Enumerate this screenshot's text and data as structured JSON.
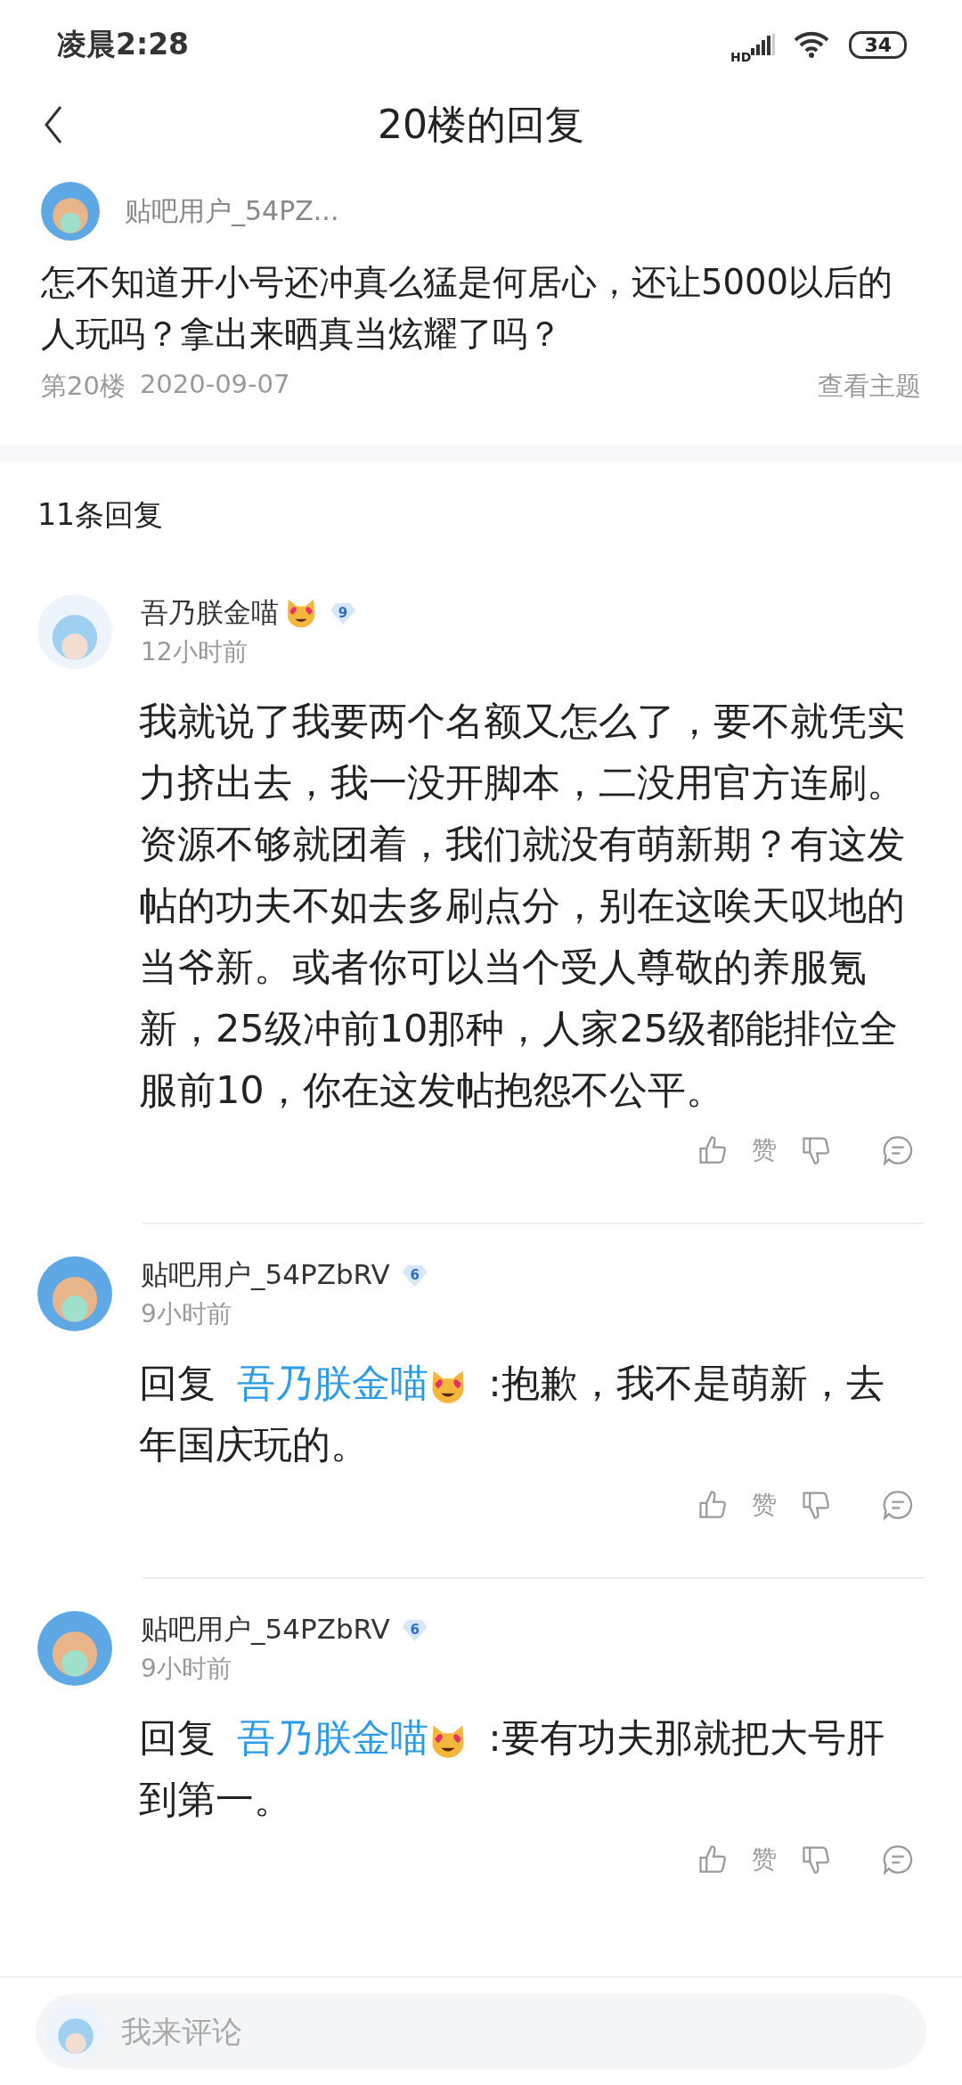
{
  "status_bar": {
    "time": "凌晨2:28",
    "network": "HD",
    "battery": "34"
  },
  "header": {
    "title": "20楼的回复"
  },
  "post": {
    "author": "贴吧用户_54PZ...",
    "text": "怎不知道开小号还冲真么猛是何居心，还让5000以后的人玩吗？拿出来晒真当炫耀了吗？",
    "floor": "第20楼",
    "date": "2020-09-07",
    "view_topic": "查看主题"
  },
  "replies_count": "11条回复",
  "replies": [
    {
      "kind": "plain",
      "author": "吾乃朕金喵",
      "author_emoji": true,
      "level": "9",
      "time": "12小时前",
      "text": "我就说了我要两个名额又怎么了，要不就凭实力挤出去，我一没开脚本，二没用官方连刷。资源不够就团着，我们就没有萌新期？有这发帖的功夫不如去多刷点分，别在这唉天叹地的当爷新。或者你可以当个受人尊敬的养服氪新，25级冲前10那种，人家25级都能排位全服前10，你在这发帖抱怨不公平。",
      "like": "赞"
    },
    {
      "kind": "reply",
      "author": "贴吧用户_54PZbRV",
      "author_emoji": false,
      "level": "6",
      "time": "9小时前",
      "reply_label": "回复",
      "reply_to": "吾乃朕金喵",
      "reply_to_emoji": true,
      "text": ":抱歉，我不是萌新，去年国庆玩的。",
      "like": "赞"
    },
    {
      "kind": "reply",
      "author": "贴吧用户_54PZbRV",
      "author_emoji": false,
      "level": "6",
      "time": "9小时前",
      "reply_label": "回复",
      "reply_to": "吾乃朕金喵",
      "reply_to_emoji": true,
      "text": ":要有功夫那就把大号肝到第一。",
      "like": "赞"
    }
  ],
  "comment_bar": {
    "placeholder": "我来评论"
  }
}
